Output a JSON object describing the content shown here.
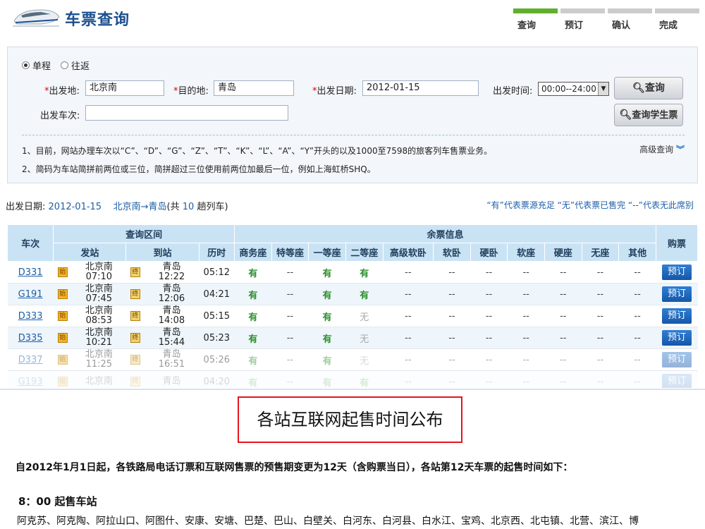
{
  "header": {
    "title": "车票查询",
    "steps": [
      "查询",
      "预订",
      "确认",
      "完成"
    ]
  },
  "search": {
    "trip_one_way": "单程",
    "trip_round": "往返",
    "from_label": "出发地:",
    "from_value": "北京南",
    "to_label": "目的地:",
    "to_value": "青岛",
    "date_label": "出发日期:",
    "date_value": "2012-01-15",
    "time_label": "出发时间:",
    "time_value": "00:00--24:00",
    "train_label": "出发车次:",
    "train_value": "",
    "query_button": "查询",
    "student_button": "查询学生票",
    "note1": "1、目前，网站办理车次以“C”、“D”、“G”、“Z”、“T”、“K”、“L”、“A”、“Y”开头的以及1000至7598的旅客列车售票业务。",
    "note2": "2、简码为车站简拼前两位或三位，简拼超过三位使用前两位加最后一位，例如上海虹桥SHQ。",
    "advanced": "高级查询"
  },
  "summary": {
    "date_label": "出发日期:",
    "date": "2012-01-15",
    "route": "北京南→青岛",
    "count_prefix": "(共",
    "count": "10",
    "count_suffix": "趟列车)",
    "legend": "“有”代表票源充足  “无”代表票已售完  “--”代表无此席别"
  },
  "table": {
    "group_query": "查询区间",
    "group_seats": "余票信息",
    "col_train": "车次",
    "col_depart": "发站",
    "col_arrive": "到站",
    "col_duration": "历时",
    "seat_cols": [
      "商务座",
      "特等座",
      "一等座",
      "二等座",
      "高级软卧",
      "软卧",
      "硬卧",
      "软座",
      "硬座",
      "无座",
      "其他"
    ],
    "col_book": "购票",
    "book_label": "预订",
    "tag_start": "始",
    "tag_end": "终",
    "rows": [
      {
        "no": "D331",
        "from": "北京南",
        "dep": "07:10",
        "to": "青岛",
        "arr": "12:22",
        "dur": "05:12",
        "seats": [
          "有",
          "--",
          "有",
          "有",
          "--",
          "--",
          "--",
          "--",
          "--",
          "--",
          "--"
        ]
      },
      {
        "no": "G191",
        "from": "北京南",
        "dep": "07:45",
        "to": "青岛",
        "arr": "12:06",
        "dur": "04:21",
        "seats": [
          "有",
          "--",
          "有",
          "有",
          "--",
          "--",
          "--",
          "--",
          "--",
          "--",
          "--"
        ]
      },
      {
        "no": "D333",
        "from": "北京南",
        "dep": "08:53",
        "to": "青岛",
        "arr": "14:08",
        "dur": "05:15",
        "seats": [
          "有",
          "--",
          "有",
          "无",
          "--",
          "--",
          "--",
          "--",
          "--",
          "--",
          "--"
        ]
      },
      {
        "no": "D335",
        "from": "北京南",
        "dep": "10:21",
        "to": "青岛",
        "arr": "15:44",
        "dur": "05:23",
        "seats": [
          "有",
          "--",
          "有",
          "无",
          "--",
          "--",
          "--",
          "--",
          "--",
          "--",
          "--"
        ]
      },
      {
        "no": "D337",
        "from": "北京南",
        "dep": "11:25",
        "to": "青岛",
        "arr": "16:51",
        "dur": "05:26",
        "seats": [
          "有",
          "--",
          "有",
          "无",
          "--",
          "--",
          "--",
          "--",
          "--",
          "--",
          "--"
        ]
      },
      {
        "no": "G193",
        "from": "北京南",
        "dep": "",
        "to": "青岛",
        "arr": "",
        "dur": "04:20",
        "seats": [
          "有",
          "--",
          "有",
          "有",
          "--",
          "--",
          "--",
          "--",
          "--",
          "--",
          "--"
        ]
      }
    ]
  },
  "announcement": {
    "title": "各站互联网起售时间公布",
    "paragraph": "自2012年1月1日起，各铁路局电话订票和互联网售票的预售期变更为12天（含购票当日），各站第12天车票的起售时间如下：",
    "subheading": "8：00 起售车站",
    "stations": "阿克苏、阿克陶、阿拉山口、阿图什、安康、安塘、巴楚、巴山、白壁关、白河东、白河县、白水江、宝鸡、北京西、北屯镇、北营、滨江、博"
  },
  "colors": {
    "accent": "#1d4f8f",
    "step_active": "#5fb12d",
    "available": "#2a8f2a",
    "book_button": "#1f6bbf",
    "highlight_border": "#e8141c"
  }
}
